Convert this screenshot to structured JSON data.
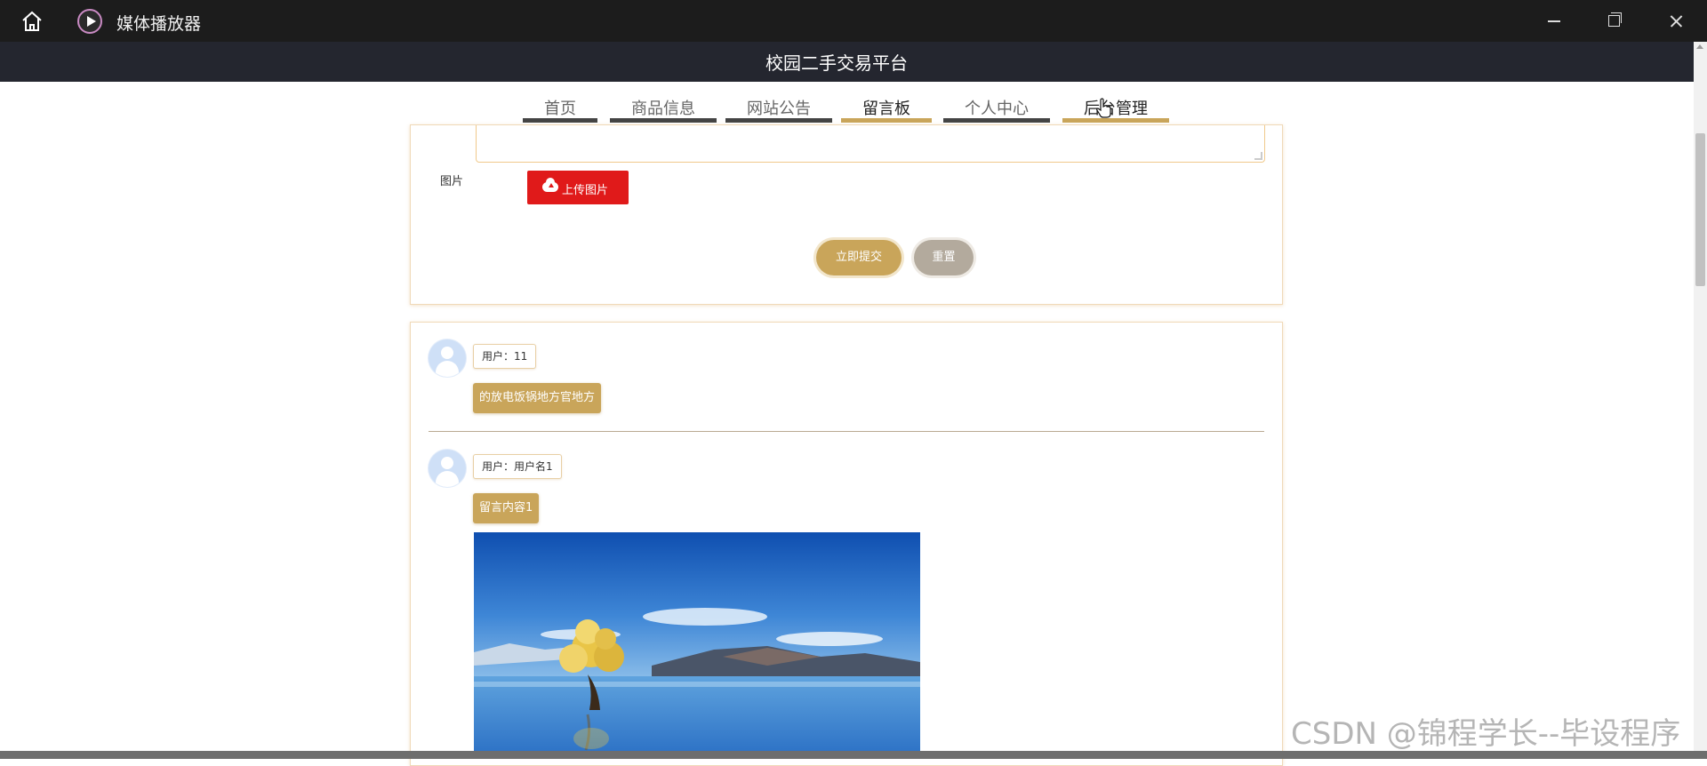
{
  "window": {
    "app_title": "媒体播放器",
    "icons": [
      "home-icon",
      "play-icon",
      "minimize-icon",
      "maximize-icon",
      "close-icon"
    ]
  },
  "site": {
    "title": "校园二手交易平台"
  },
  "nav": {
    "items": [
      {
        "label": "首页"
      },
      {
        "label": "商品信息"
      },
      {
        "label": "网站公告"
      },
      {
        "label": "留言板"
      },
      {
        "label": "个人中心"
      },
      {
        "label": "后台管理"
      }
    ],
    "active": "留言板"
  },
  "form": {
    "image_label": "图片",
    "upload_label": "上传图片",
    "submit_label": "立即提交",
    "reset_label": "重置"
  },
  "comments": [
    {
      "user": "用户：11",
      "content": "的放电饭锅地方官地方"
    },
    {
      "user": "用户：用户名1",
      "content": "留言内容1",
      "has_image": true
    }
  ],
  "watermark": "CSDN @锦程学长--毕设程序",
  "colors": {
    "titlebar": "#1c1c1c",
    "header": "#24262f",
    "gold": "#c9a55a",
    "upload_red": "#e01a1a",
    "reset_gray": "#b3aa9d"
  }
}
